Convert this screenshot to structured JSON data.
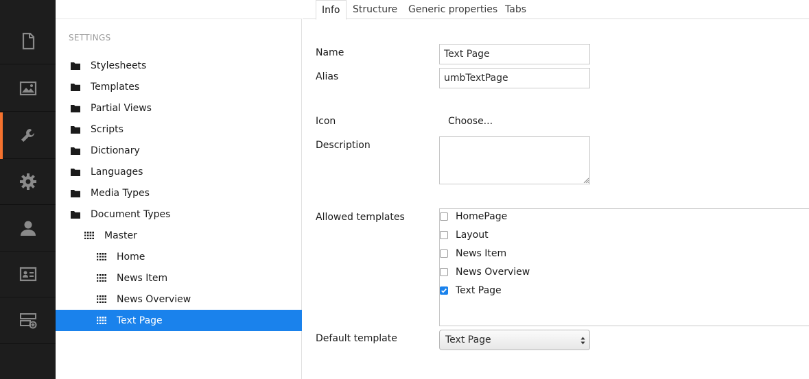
{
  "sections": [
    {
      "name": "content",
      "icon": "document-icon"
    },
    {
      "name": "media",
      "icon": "image-icon"
    },
    {
      "name": "settings",
      "icon": "wrench-icon",
      "active": true
    },
    {
      "name": "developer",
      "icon": "gear-icon"
    },
    {
      "name": "users",
      "icon": "user-icon"
    },
    {
      "name": "members",
      "icon": "id-card-icon"
    },
    {
      "name": "forms",
      "icon": "add-server-icon"
    }
  ],
  "tree": {
    "heading": "SETTINGS",
    "items": [
      {
        "label": "Stylesheets",
        "icon": "folder-icon"
      },
      {
        "label": "Templates",
        "icon": "folder-icon"
      },
      {
        "label": "Partial Views",
        "icon": "folder-icon"
      },
      {
        "label": "Scripts",
        "icon": "folder-icon"
      },
      {
        "label": "Dictionary",
        "icon": "folder-icon"
      },
      {
        "label": "Languages",
        "icon": "folder-icon"
      },
      {
        "label": "Media Types",
        "icon": "folder-icon"
      },
      {
        "label": "Document Types",
        "icon": "folder-icon"
      },
      {
        "label": "Master",
        "icon": "doctype-icon"
      },
      {
        "label": "Home",
        "icon": "doctype-icon"
      },
      {
        "label": "News Item",
        "icon": "doctype-icon"
      },
      {
        "label": "News Overview",
        "icon": "doctype-icon"
      },
      {
        "label": "Text Page",
        "icon": "doctype-icon",
        "selected": true
      }
    ]
  },
  "tabs": [
    {
      "label": "Info",
      "active": true
    },
    {
      "label": "Structure"
    },
    {
      "label": "Generic properties"
    },
    {
      "label": "Tabs"
    }
  ],
  "form": {
    "name_label": "Name",
    "name_value": "Text Page",
    "alias_label": "Alias",
    "alias_value": "umbTextPage",
    "icon_label": "Icon",
    "icon_choose": "Choose...",
    "description_label": "Description",
    "description_value": "",
    "allowed_templates_label": "Allowed templates",
    "templates": [
      {
        "label": "HomePage",
        "checked": false
      },
      {
        "label": "Layout",
        "checked": false
      },
      {
        "label": "News Item",
        "checked": false
      },
      {
        "label": "News Overview",
        "checked": false
      },
      {
        "label": "Text Page",
        "checked": true
      }
    ],
    "default_template_label": "Default template",
    "default_template_value": "Text Page"
  },
  "colors": {
    "accent": "#f5722e",
    "selected": "#1a82ec",
    "sidebar": "#1d1d1d"
  }
}
